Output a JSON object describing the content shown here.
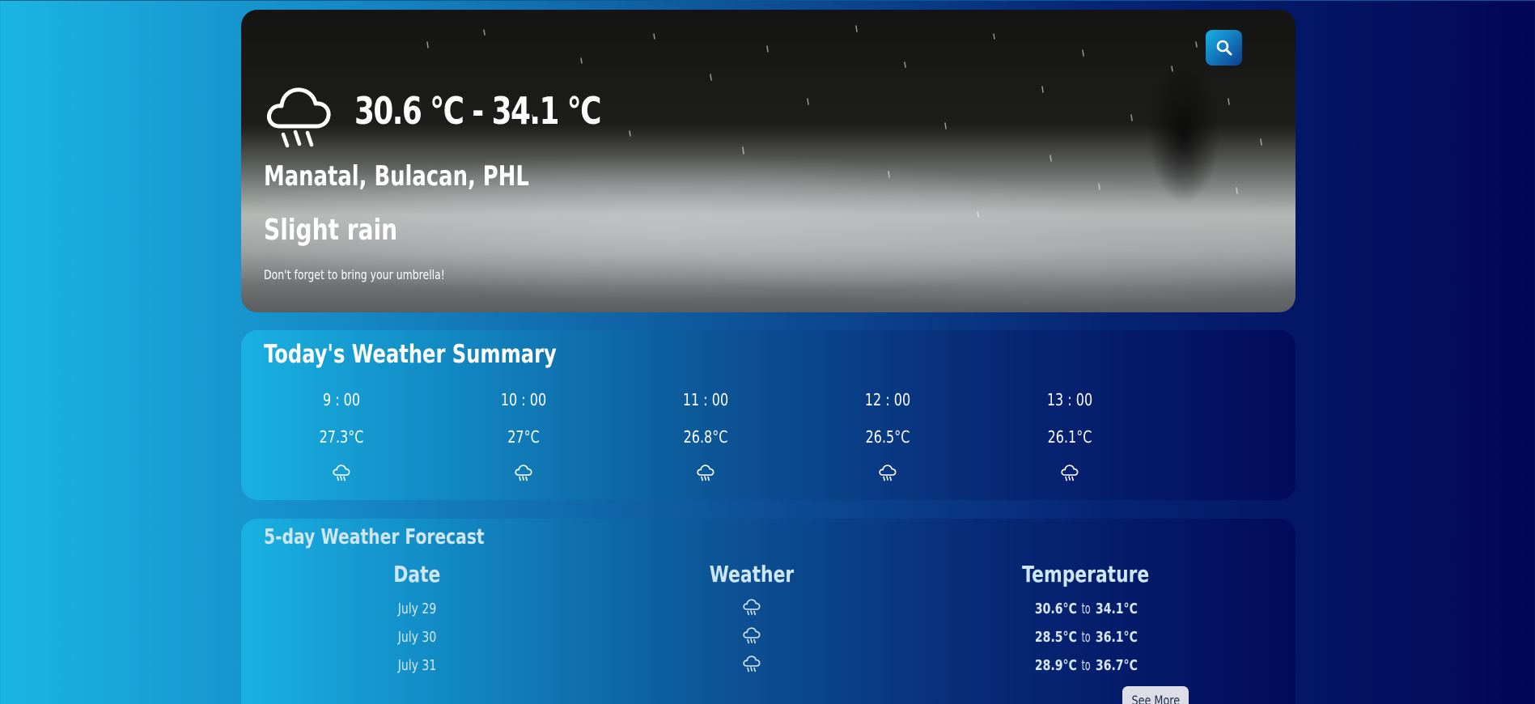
{
  "hero": {
    "temperature_range": "30.6 °C - 34.1 °C",
    "location": "Manatal, Bulacan, PHL",
    "condition": "Slight rain",
    "tip": "Don't forget to bring your umbrella!",
    "weather_icon": "rain-cloud-icon",
    "search_icon": "search-icon"
  },
  "summary": {
    "title": "Today's Weather Summary",
    "hours": [
      {
        "time": "9 : 00",
        "temp": "27.3°C",
        "icon": "rain-cloud-icon"
      },
      {
        "time": "10 : 00",
        "temp": "27°C",
        "icon": "rain-cloud-icon"
      },
      {
        "time": "11 : 00",
        "temp": "26.8°C",
        "icon": "rain-cloud-icon"
      },
      {
        "time": "12 : 00",
        "temp": "26.5°C",
        "icon": "rain-cloud-icon"
      },
      {
        "time": "13 : 00",
        "temp": "26.1°C",
        "icon": "rain-cloud-icon"
      }
    ]
  },
  "forecast": {
    "title": "5-day Weather Forecast",
    "headers": {
      "date": "Date",
      "weather": "Weather",
      "temperature": "Temperature"
    },
    "rows": [
      {
        "date": "July 29",
        "icon": "rain-cloud-icon",
        "min": "30.6°C",
        "sep": "to",
        "max": "34.1°C"
      },
      {
        "date": "July 30",
        "icon": "rain-cloud-icon",
        "min": "28.5°C",
        "sep": "to",
        "max": "36.1°C"
      },
      {
        "date": "July 31",
        "icon": "rain-cloud-icon",
        "min": "28.9°C",
        "sep": "to",
        "max": "36.7°C"
      }
    ],
    "see_more_label": "See More"
  }
}
